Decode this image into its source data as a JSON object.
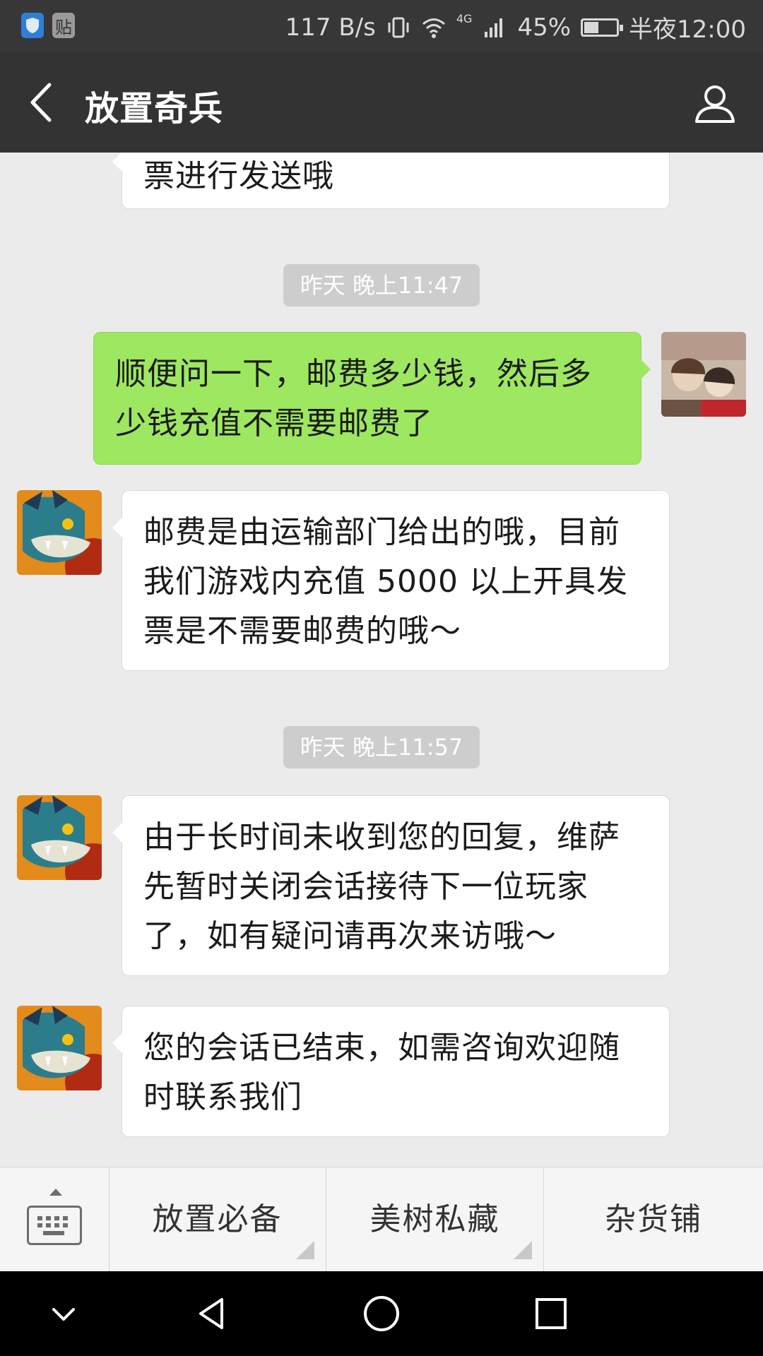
{
  "status_bar": {
    "speed": "117 B/s",
    "network": "4G",
    "battery_percent_label": "45%",
    "battery_level": 0.45,
    "time": "半夜12:00",
    "notification_icons": [
      "shield-app-icon",
      "tieba-app-icon"
    ],
    "tie_glyph": "贴"
  },
  "header": {
    "title": "放置奇兵"
  },
  "messages": [
    {
      "type": "in-partial",
      "text": "票进行发送哦"
    },
    {
      "type": "time",
      "text": "昨天 晚上11:47"
    },
    {
      "type": "out",
      "text": "顺便问一下，邮费多少钱，然后多少钱充值不需要邮费了"
    },
    {
      "type": "in",
      "text": "邮费是由运输部门给出的哦，目前我们游戏内充值 5000 以上开具发票是不需要邮费的哦～"
    },
    {
      "type": "time",
      "text": "昨天 晚上11:57"
    },
    {
      "type": "in",
      "text": "由于长时间未收到您的回复，维萨先暂时关闭会话接待下一位玩家了，如有疑问请再次来访哦～"
    },
    {
      "type": "in",
      "text": "您的会话已结束，如需咨询欢迎随时联系我们"
    }
  ],
  "menu": {
    "items": [
      "放置必备",
      "美树私藏",
      "杂货铺"
    ]
  },
  "colors": {
    "header_bg": "#333333",
    "chat_bg": "#ebebeb",
    "outgoing_bubble": "#9ee760",
    "incoming_bubble": "#ffffff"
  }
}
